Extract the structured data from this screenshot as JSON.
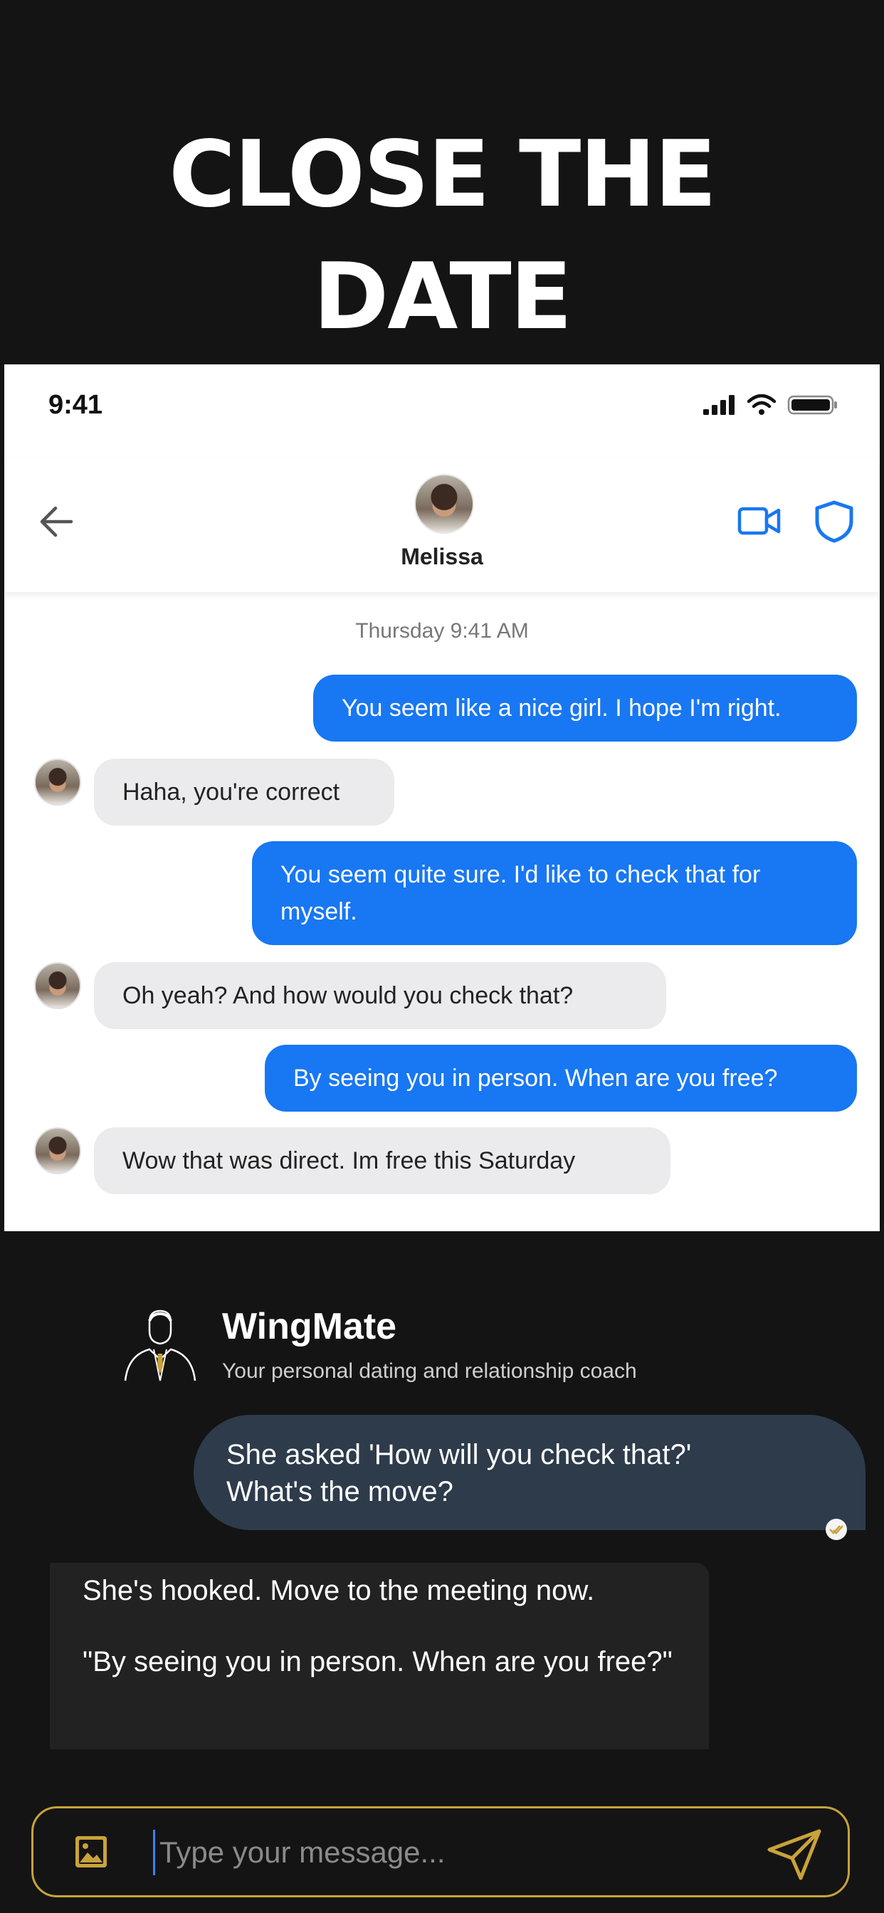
{
  "headline": {
    "line1": "CLOSE THE",
    "line2": "DATE"
  },
  "phone": {
    "status_time": "9:41",
    "contact_name": "Melissa",
    "timestamp": "Thursday 9:41 AM",
    "messages": [
      {
        "dir": "out",
        "text": "You seem like a nice girl. I hope I'm right."
      },
      {
        "dir": "in",
        "text": "Haha, you're correct"
      },
      {
        "dir": "out",
        "line1": "You seem quite sure. I'd like to check that for",
        "line2": "myself."
      },
      {
        "dir": "in",
        "text": "Oh yeah? And how would you check that?"
      },
      {
        "dir": "out",
        "text": "By seeing you in person. When are you free?"
      },
      {
        "dir": "in",
        "text": "Wow that was direct. Im free this Saturday"
      }
    ],
    "colors": {
      "outgoing": "#1877f2",
      "incoming": "#ebebed",
      "icon_accent": "#1877f2"
    }
  },
  "coach": {
    "name": "WingMate",
    "tagline": "Your personal dating and relationship coach",
    "user_message_line1": "She asked 'How will you check that?'",
    "user_message_line2": "What's the move?",
    "reply": "She's hooked. Move to the meeting now.\n\n\"By seeing you in person. When are you free?\"",
    "input_placeholder": "Type your message...",
    "accent_color": "#c9a23a",
    "icons": {
      "logo": "suited-man-icon",
      "attach": "image-icon",
      "send": "send-icon",
      "read": "read-receipt-icon"
    }
  }
}
